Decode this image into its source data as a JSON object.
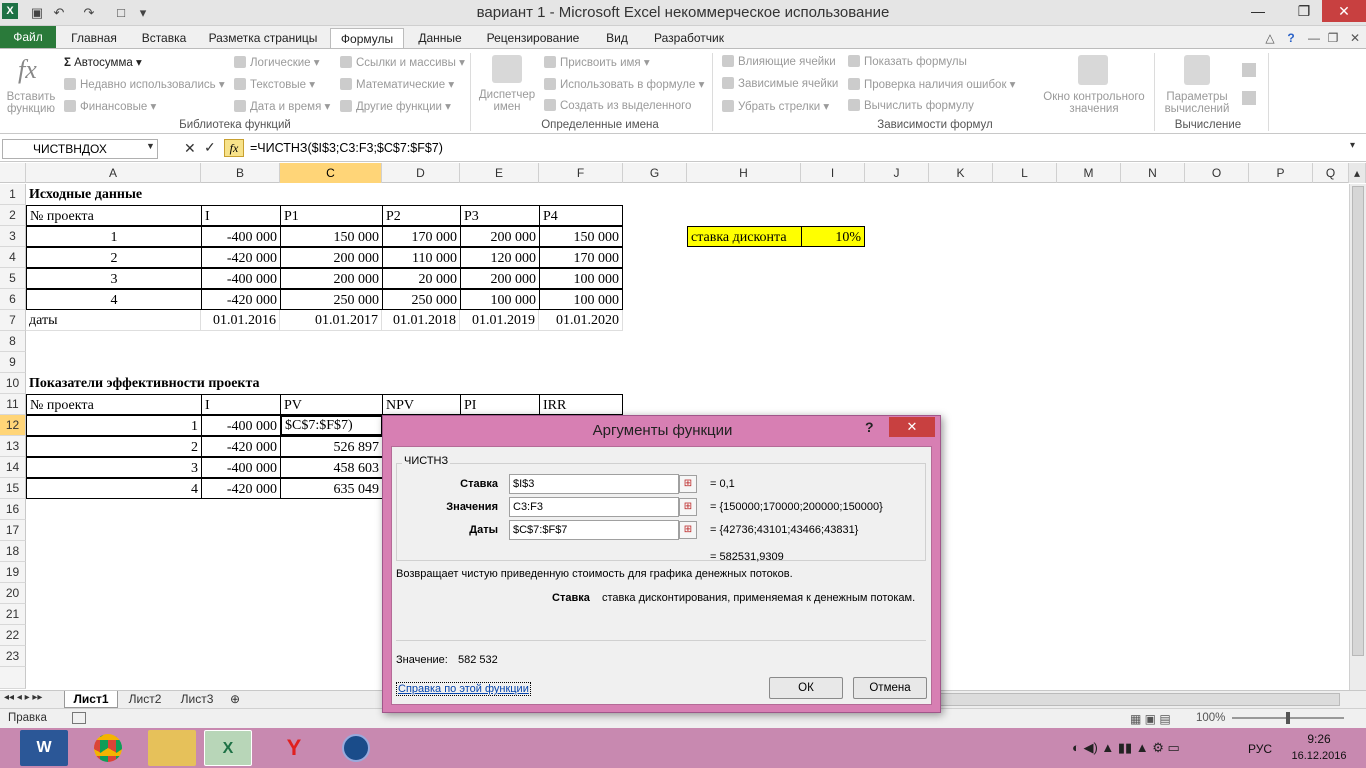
{
  "window": {
    "title": "вариант 1 - Microsoft Excel некоммерческое использование"
  },
  "tabs": [
    "Файл",
    "Главная",
    "Вставка",
    "Разметка страницы",
    "Формулы",
    "Данные",
    "Рецензирование",
    "Вид",
    "Разработчик"
  ],
  "ribbon": {
    "insert_function": "Вставить функцию",
    "autosum": "Автосумма",
    "recent": "Недавно использовались",
    "financial": "Финансовые",
    "logical": "Логические",
    "text": "Текстовые",
    "datetime": "Дата и время",
    "lookup": "Ссылки и массивы",
    "math": "Математические",
    "other": "Другие функции",
    "group_library": "Библиотека функций",
    "name_manager": "Диспетчер имен",
    "assign_name": "Присвоить имя",
    "use_in_formula": "Использовать в формуле",
    "create_from_selection": "Создать из выделенного",
    "group_names": "Определенные имена",
    "trace_precedents": "Влияющие ячейки",
    "trace_dependents": "Зависимые ячейки",
    "remove_arrows": "Убрать стрелки",
    "show_formulas": "Показать формулы",
    "error_checking": "Проверка наличия ошибок",
    "evaluate_formula": "Вычислить формулу",
    "group_auditing": "Зависимости формул",
    "watch_window": "Окно контрольного значения",
    "calc_options": "Параметры вычислений",
    "group_calc": "Вычисление"
  },
  "formula_bar": {
    "name_box": "ЧИСТВНДОХ",
    "formula": "=ЧИСТНЗ($I$3;C3:F3;$C$7:$F$7)"
  },
  "columns": [
    "A",
    "B",
    "C",
    "D",
    "E",
    "F",
    "G",
    "H",
    "I",
    "J",
    "K",
    "L",
    "M",
    "N",
    "O",
    "P",
    "Q"
  ],
  "rows": [
    "1",
    "2",
    "3",
    "4",
    "5",
    "6",
    "7",
    "8",
    "9",
    "10",
    "11",
    "12",
    "13",
    "14",
    "15",
    "16",
    "17",
    "18",
    "19",
    "20",
    "21",
    "22",
    "23"
  ],
  "sheet": {
    "a1": "Исходные данные",
    "hdr": [
      "№ проекта",
      "I",
      "P1",
      "P2",
      "P3",
      "P4"
    ],
    "data": [
      [
        "1",
        "-400 000",
        "150 000",
        "170 000",
        "200 000",
        "150 000"
      ],
      [
        "2",
        "-420 000",
        "200 000",
        "110 000",
        "120 000",
        "170 000"
      ],
      [
        "3",
        "-400 000",
        "200 000",
        "20 000",
        "200 000",
        "100 000"
      ],
      [
        "4",
        "-420 000",
        "250 000",
        "250 000",
        "100 000",
        "100 000"
      ]
    ],
    "dates_label": "даты",
    "dates": [
      "01.01.2016",
      "01.01.2017",
      "01.01.2018",
      "01.01.2019",
      "01.01.2020"
    ],
    "discount_label": "ставка дисконта",
    "discount_value": "10%",
    "a10": "Показатели эффективности проекта",
    "hdr2": [
      "№ проекта",
      "I",
      "PV",
      "NPV",
      "PI",
      "IRR"
    ],
    "eff": [
      [
        "1",
        "-400 000",
        "$C$7:$F$7)"
      ],
      [
        "2",
        "-420 000",
        "526 897"
      ],
      [
        "3",
        "-400 000",
        "458 603"
      ],
      [
        "4",
        "-420 000",
        "635 049"
      ]
    ]
  },
  "sheet_tabs": [
    "Лист1",
    "Лист2",
    "Лист3"
  ],
  "status": {
    "mode": "Правка",
    "zoom": "100%"
  },
  "taskbar": {
    "lang": "РУС",
    "time": "9:26",
    "date": "16.12.2016"
  },
  "dialog": {
    "title": "Аргументы функции",
    "func": "ЧИСТНЗ",
    "args": [
      {
        "label": "Ставка",
        "value": "$I$3",
        "result": "0,1"
      },
      {
        "label": "Значения",
        "value": "C3:F3",
        "result": "{150000;170000;200000;150000}"
      },
      {
        "label": "Даты",
        "value": "$C$7:$F$7",
        "result": "{42736;43101;43466;43831}"
      }
    ],
    "total": "582531,9309",
    "description": "Возвращает чистую приведенную стоимость для графика денежных потоков.",
    "arg_name": "Ставка",
    "arg_desc": "ставка дисконтирования, применяемая к денежным потокам.",
    "value_label": "Значение:",
    "value": "582 532",
    "help": "Справка по этой функции",
    "ok": "ОК",
    "cancel": "Отмена"
  }
}
